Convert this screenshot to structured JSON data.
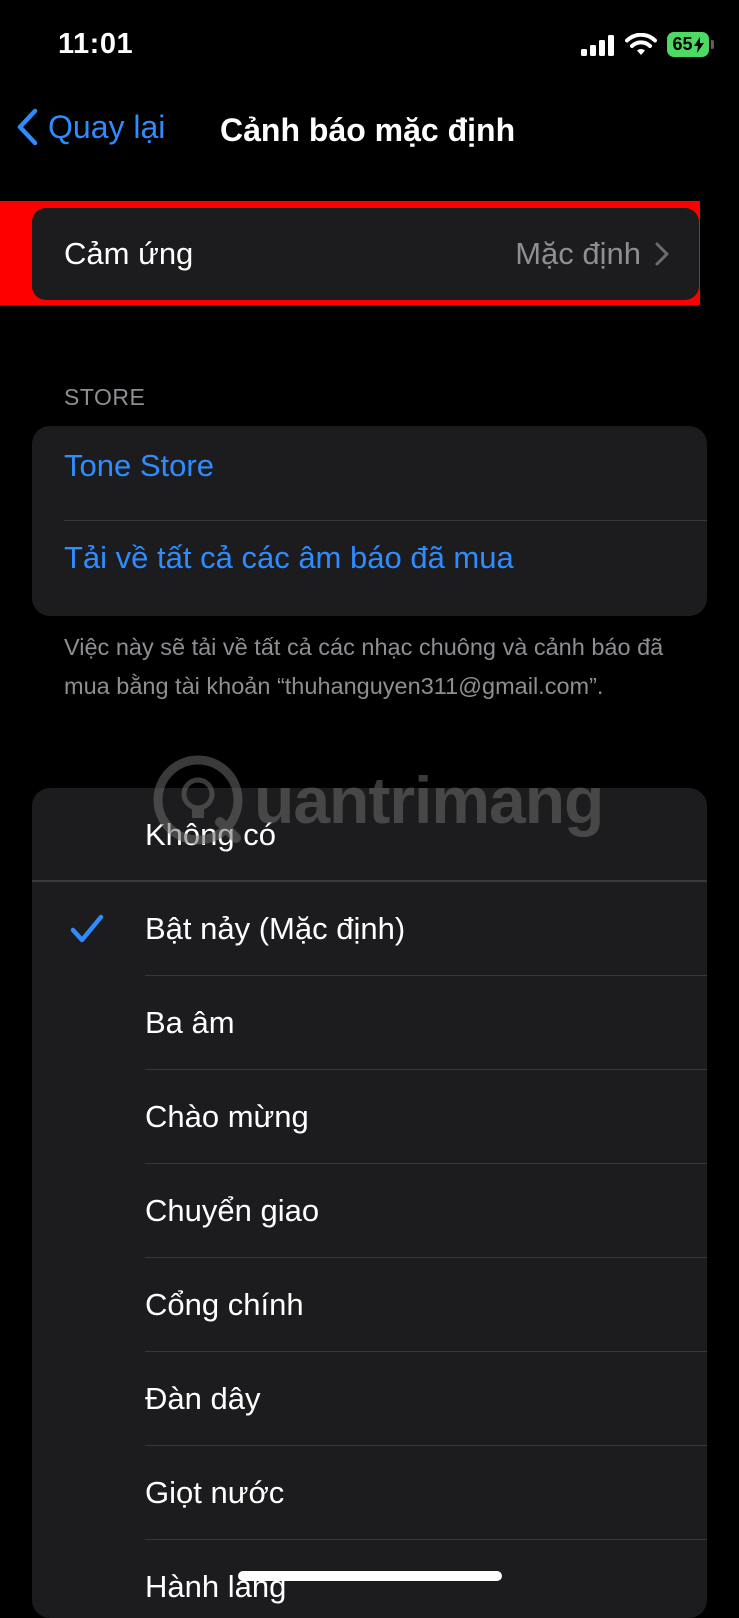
{
  "status_bar": {
    "time": "11:01",
    "battery": "65"
  },
  "nav": {
    "back_label": "Quay lại",
    "title": "Cảnh báo mặc định"
  },
  "haptics": {
    "label": "Cảm ứng",
    "value": "Mặc định"
  },
  "store": {
    "header": "STORE",
    "items": [
      "Tone Store",
      "Tải về tất cả các âm báo đã mua"
    ],
    "footer": "Việc này sẽ tải về tất cả các nhạc chuông và cảnh báo đã mua bằng tài khoản “thuhanguyen311@gmail.com”."
  },
  "tones": {
    "selected_index": 1,
    "items": [
      "Không có",
      "Bật nảy (Mặc định)",
      "Ba âm",
      "Chào mừng",
      "Chuyển giao",
      "Cổng chính",
      "Đàn dây",
      "Giọt nước",
      "Hành lang"
    ]
  },
  "watermark": {
    "text": "uantrimang"
  },
  "colors": {
    "accent": "#2f8cff",
    "highlight": "#ff0000",
    "battery": "#4cd964"
  }
}
